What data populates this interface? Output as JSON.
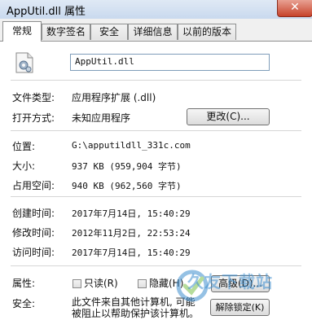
{
  "window": {
    "title": "AppUtil.dll 属性",
    "close_glyph": "✕"
  },
  "tabs": [
    {
      "label": "常规",
      "active": true
    },
    {
      "label": "数字签名",
      "active": false
    },
    {
      "label": "安全",
      "active": false
    },
    {
      "label": "详细信息",
      "active": false
    },
    {
      "label": "以前的版本",
      "active": false
    }
  ],
  "file": {
    "name": "AppUtil.dll",
    "icon": "dll-file-icon"
  },
  "props": {
    "type_label": "文件类型:",
    "type_value": "应用程序扩展 (.dll)",
    "open_label": "打开方式:",
    "open_value": "未知应用程序",
    "change_button": "更改(C)...",
    "location_label": "位置:",
    "location_value": "G:\\apputildll_331c.com",
    "size_label": "大小:",
    "size_value": "937 KB (959,904 字节)",
    "disk_label": "占用空间:",
    "disk_value": "940 KB (962,560 字节)",
    "created_label": "创建时间:",
    "created_value": "2017年7月14日, 15:40:29",
    "modified_label": "修改时间:",
    "modified_value": "2012年11月2日, 22:53:24",
    "accessed_label": "访问时间:",
    "accessed_value": "2017年7月14日, 15:40:29",
    "attr_label": "属性:",
    "readonly_label": "只读(R)",
    "hidden_label": "隐藏(H)",
    "advanced_button": "高级(D)...",
    "security_label": "安全:",
    "security_text_1": "此文件来自其他计算机, 可能",
    "security_text_2": "被阻止以帮助保护该计算机。",
    "unblock_button": "解除锁定(K)"
  },
  "watermark": {
    "text": "久友下载站"
  },
  "colors": {
    "accent": "#3f8fcf",
    "titlebar": "#c9d9ee",
    "close": "#c7432b"
  }
}
